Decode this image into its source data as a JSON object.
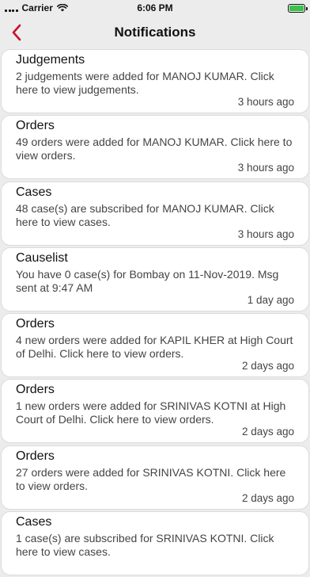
{
  "status": {
    "carrier": "Carrier",
    "time": "6:06 PM"
  },
  "nav": {
    "title": "Notifications"
  },
  "notifications": [
    {
      "title": "Judgements",
      "body": "2 judgements were added for MANOJ KUMAR. Click here to view judgements.",
      "time": "3 hours ago"
    },
    {
      "title": "Orders",
      "body": "49 orders were added for MANOJ KUMAR. Click here to view orders.",
      "time": "3 hours ago"
    },
    {
      "title": "Cases",
      "body": "48 case(s) are subscribed for MANOJ KUMAR. Click here to view cases.",
      "time": "3 hours ago"
    },
    {
      "title": "Causelist",
      "body": "You have 0 case(s) for Bombay on 11-Nov-2019. Msg sent at 9:47 AM",
      "time": "1 day ago"
    },
    {
      "title": "Orders",
      "body": "4 new orders were added for KAPIL KHER at High Court of Delhi. Click here to view orders.",
      "time": "2 days ago"
    },
    {
      "title": "Orders",
      "body": "1 new orders were added for SRINIVAS KOTNI at High Court of Delhi. Click here to view orders.",
      "time": "2 days ago"
    },
    {
      "title": "Orders",
      "body": "27 orders were added for SRINIVAS KOTNI. Click here to view orders.",
      "time": "2 days ago"
    },
    {
      "title": "Cases",
      "body": "1 case(s) are subscribed for SRINIVAS KOTNI. Click here to view cases.",
      "time": ""
    }
  ]
}
